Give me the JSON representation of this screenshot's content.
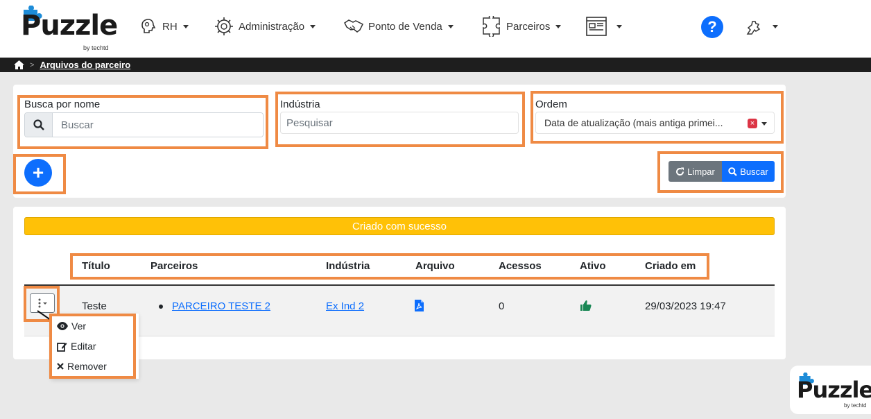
{
  "brand": {
    "name": "Puzzle",
    "tagline": "by techtd"
  },
  "nav": {
    "items": [
      {
        "label": "RH",
        "icon": "brain-icon"
      },
      {
        "label": "Administração",
        "icon": "cog-brain-icon"
      },
      {
        "label": "Ponto de Venda",
        "icon": "handshake-icon"
      },
      {
        "label": "Parceiros",
        "icon": "puzzle-icon"
      },
      {
        "label": "",
        "icon": "layout-icon"
      }
    ],
    "help": "?"
  },
  "breadcrumb": {
    "current": "Arquivos do parceiro"
  },
  "filters": {
    "name_label": "Busca por nome",
    "name_placeholder": "Buscar",
    "industry_label": "Indústria",
    "industry_placeholder": "Pesquisar",
    "order_label": "Ordem",
    "order_value": "Data de atualização (mais antiga primei...",
    "clear_x": "×"
  },
  "actions": {
    "add": "+",
    "clear": "Limpar",
    "search": "Buscar"
  },
  "alert": {
    "message": "Criado com sucesso",
    "color": "#ffc107"
  },
  "table": {
    "headers": [
      "Título",
      "Parceiros",
      "Indústria",
      "Arquivo",
      "Acessos",
      "Ativo",
      "Criado em"
    ],
    "rows": [
      {
        "titulo": "Teste",
        "parceiro": "PARCEIRO TESTE 2",
        "industria": "Ex Ind 2",
        "arquivo_icon": "pdf-icon",
        "acessos": "0",
        "ativo_icon": "thumbs-up-icon",
        "criado_em": "29/03/2023 19:47"
      }
    ]
  },
  "row_menu": {
    "view": "Ver",
    "edit": "Editar",
    "remove": "Remover"
  },
  "colors": {
    "primary": "#0d6efd",
    "highlight": "#ef8a44",
    "secondary": "#6c757d",
    "success": "#198754"
  }
}
